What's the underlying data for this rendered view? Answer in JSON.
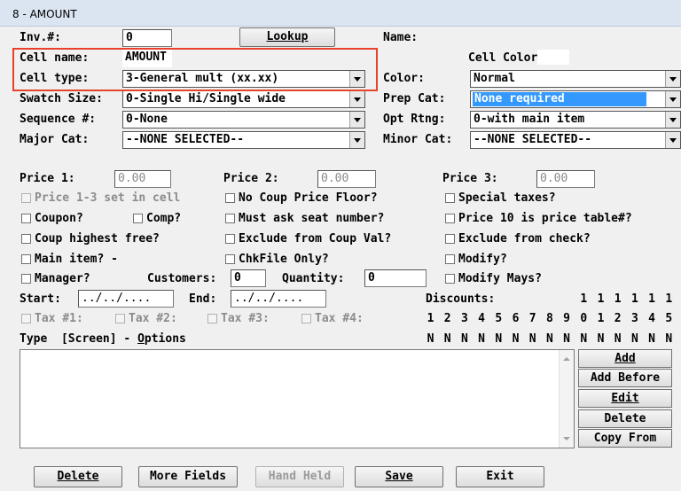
{
  "window": {
    "title": "8 - AMOUNT"
  },
  "labels": {
    "inv": "Inv.#:",
    "name": "Name:",
    "cell_name": "Cell name:",
    "cell_color": "Cell Color",
    "cell_type": "Cell type:",
    "color": "Color:",
    "swatch_size": "Swatch Size:",
    "prep_cat": "Prep Cat:",
    "sequence": "Sequence #:",
    "opt_rtng": "Opt Rtng:",
    "major_cat": "Major Cat:",
    "minor_cat": "Minor Cat:",
    "price1": "Price 1:",
    "price2": "Price 2:",
    "price3": "Price 3:",
    "customers": "Customers:",
    "quantity": "Quantity:",
    "start": "Start:",
    "end": "End:",
    "discounts": "Discounts:",
    "type_header_a": "Type  [Screen] - ",
    "type_header_b": "O",
    "type_header_c": "ptions"
  },
  "fields": {
    "inv_value": "0",
    "lookup_button": "Lookup",
    "cell_name_value": "AMOUNT",
    "cell_type_value": "3-General mult (xx.xx)",
    "swatch_size_value": "0-Single Hi/Single wide",
    "sequence_value": "0-None",
    "major_cat_value": "--NONE SELECTED--",
    "color_value": "Normal",
    "prep_cat_value": "None required",
    "opt_rtng_value": "0-with main item",
    "minor_cat_value": "--NONE SELECTED--",
    "price1_value": "0.00",
    "price2_value": "0.00",
    "price3_value": "0.00",
    "customers_value": "0",
    "quantity_value": "0",
    "start_value": "../../....",
    "end_value": "../../...."
  },
  "checkboxes": {
    "price_set_in_cell": "Price 1-3 set in cell",
    "no_coup_price_floor": "No Coup Price Floor?",
    "special_taxes": "Special taxes?",
    "coupon": "Coupon?",
    "comp": "Comp?",
    "must_ask_seat": "Must ask seat number?",
    "price10_table": "Price 10 is price table#?",
    "coup_highest_free": "Coup highest free?",
    "exclude_coup_val": "Exclude from Coup Val?",
    "exclude_check": "Exclude from check?",
    "main_item": "Main item? -",
    "chkfile_only": "ChkFile Only?",
    "modify": "Modify?",
    "manager": "Manager?",
    "modify_mays": "Modify Mays?",
    "tax1": "Tax #1:",
    "tax2": "Tax #2:",
    "tax3": "Tax #3:",
    "tax4": "Tax #4:"
  },
  "discounts": {
    "tens": [
      "",
      "",
      "",
      "",
      "",
      "",
      "",
      "",
      "",
      "1",
      "1",
      "1",
      "1",
      "1",
      "1"
    ],
    "ones": [
      "1",
      "2",
      "3",
      "4",
      "5",
      "6",
      "7",
      "8",
      "9",
      "0",
      "1",
      "2",
      "3",
      "4",
      "5"
    ],
    "flags": [
      "N",
      "N",
      "N",
      "N",
      "N",
      "N",
      "N",
      "N",
      "N",
      "N",
      "N",
      "N",
      "N",
      "N",
      "N"
    ]
  },
  "side_buttons": {
    "add": "Add",
    "add_before": "Add Before",
    "edit": "Edit",
    "delete": "Delete",
    "copy_from": "Copy From"
  },
  "bottom_buttons": {
    "delete": "Delete",
    "more_fields": "More Fields",
    "hand_held": "Hand Held",
    "save": "Save",
    "exit": "Exit"
  },
  "colors": {
    "highlight_box": "#e8412c",
    "selection": "#3399ff"
  }
}
